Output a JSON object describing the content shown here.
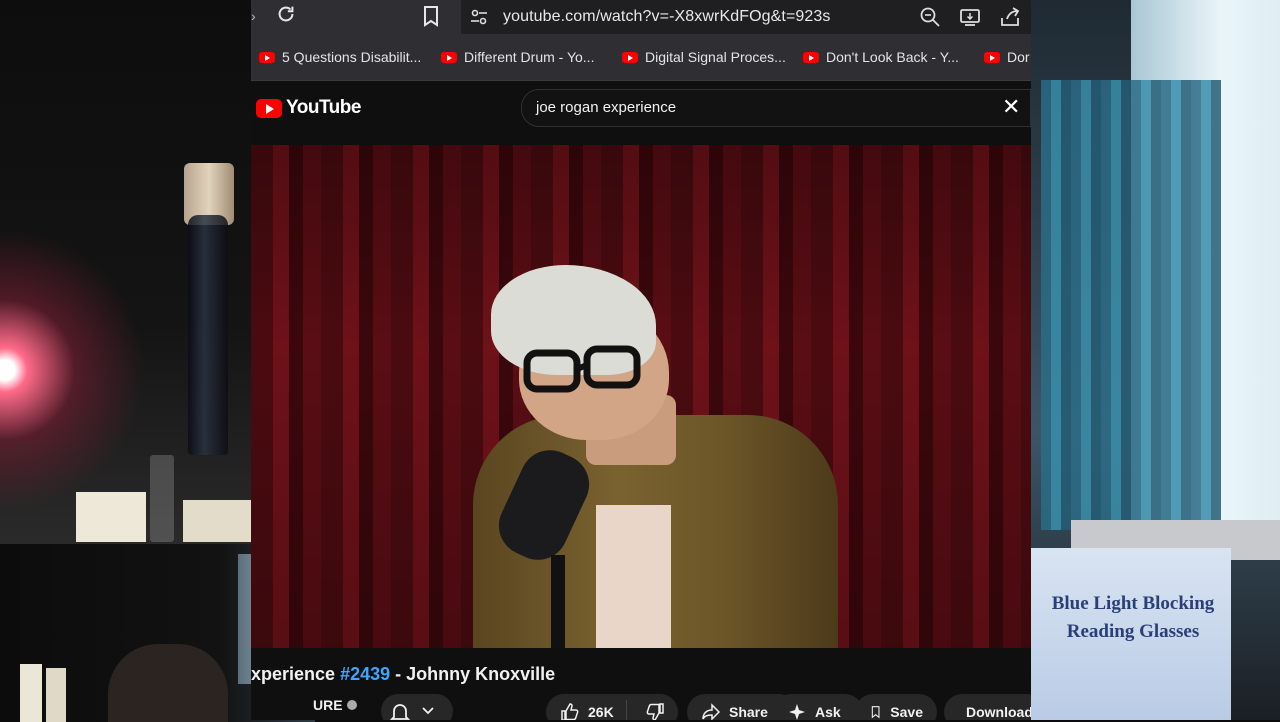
{
  "browser": {
    "url": "youtube.com/watch?v=-X8xwrKdFOg&t=923s"
  },
  "bookmarks": [
    {
      "label": "5 Questions Disabilit..."
    },
    {
      "label": "Different Drum - Yo..."
    },
    {
      "label": "Digital Signal Proces..."
    },
    {
      "label": "Don't Look Back - Y..."
    },
    {
      "label": "Dor"
    }
  ],
  "youtube": {
    "logo_text": "YouTube",
    "search_query": "joe rogan experience"
  },
  "video": {
    "title_prefix": "xperience ",
    "episode": "#2439",
    "title_suffix": " - Johnny Knoxville",
    "channel": "URE"
  },
  "actions": {
    "likes": "26K",
    "share": "Share",
    "ask": "Ask",
    "save": "Save",
    "download": "Download"
  },
  "webcam": {
    "product_text_1": "Blue Light Blocking",
    "product_text_2": "Reading Glasses"
  },
  "colors": {
    "youtube_red": "#ff0000",
    "hashtag_blue": "#3ea6ff",
    "chrome_bg": "#2f2f33"
  }
}
